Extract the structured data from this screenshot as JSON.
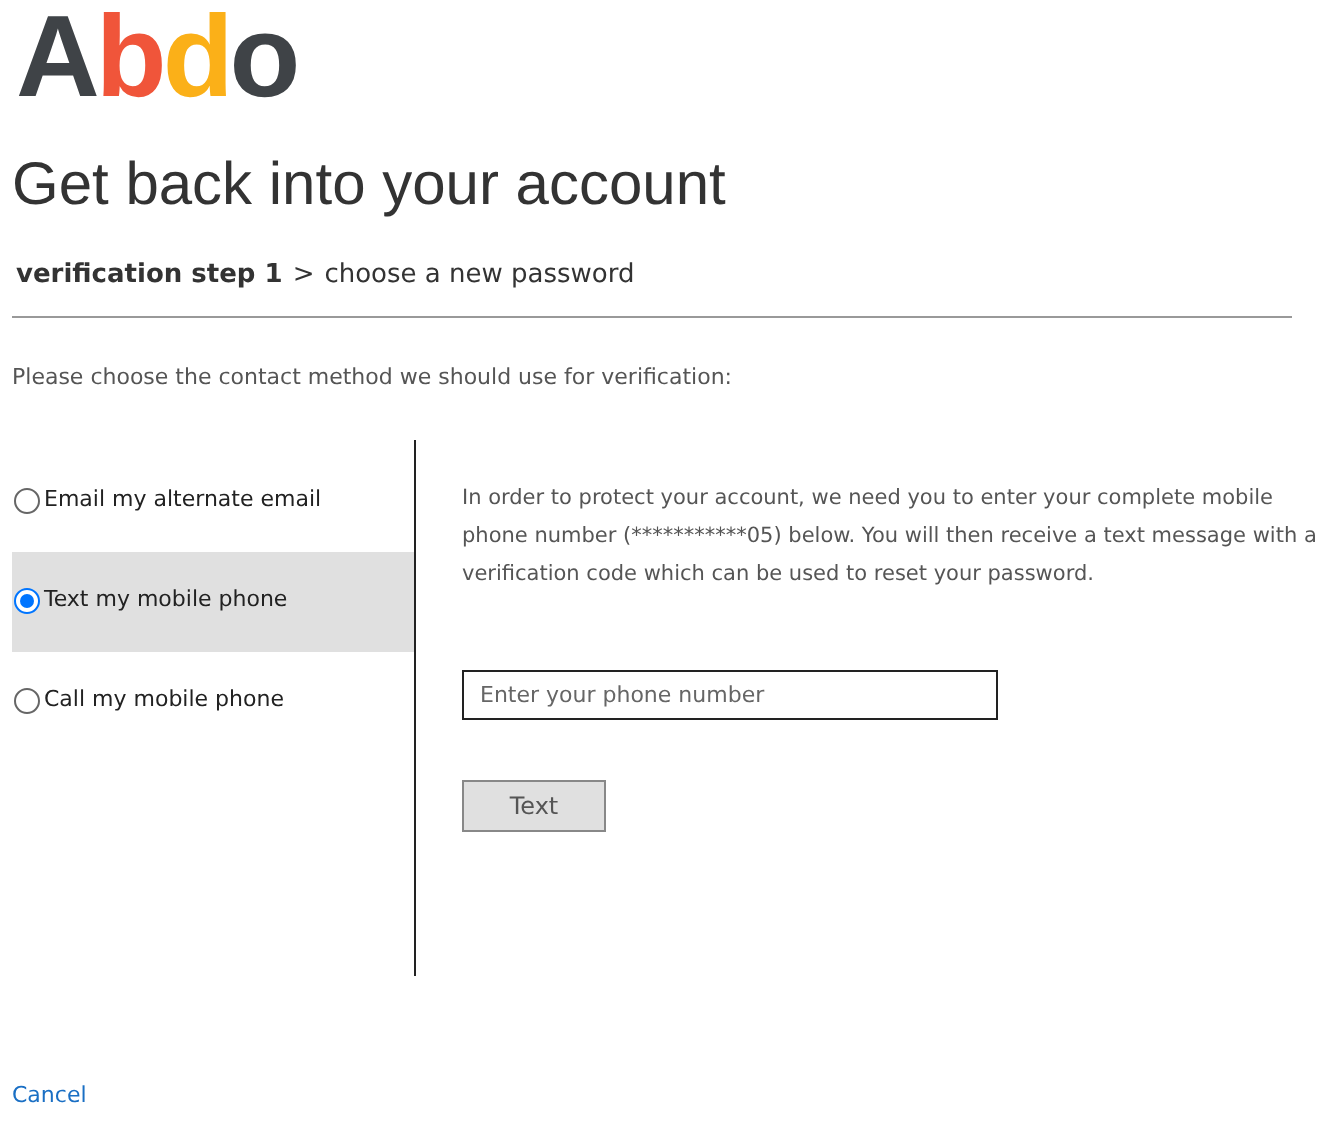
{
  "logo": "Abdo",
  "title": "Get back into your account",
  "steps": {
    "current": "verification step 1",
    "separator": ">",
    "next": "choose a new password"
  },
  "prompt": "Please choose the contact method we should use for verification:",
  "methods": [
    {
      "label": "Email my alternate email",
      "selected": false
    },
    {
      "label": "Text my mobile phone",
      "selected": true
    },
    {
      "label": "Call my mobile phone",
      "selected": false
    }
  ],
  "instructions": "In order to protect your account, we need you to enter your complete mobile phone number (***********05) below. You will then receive a text message with a verification code which can be used to reset your password.",
  "phone_field": {
    "placeholder": "Enter your phone number"
  },
  "send_button": "Text",
  "cancel_link": "Cancel"
}
